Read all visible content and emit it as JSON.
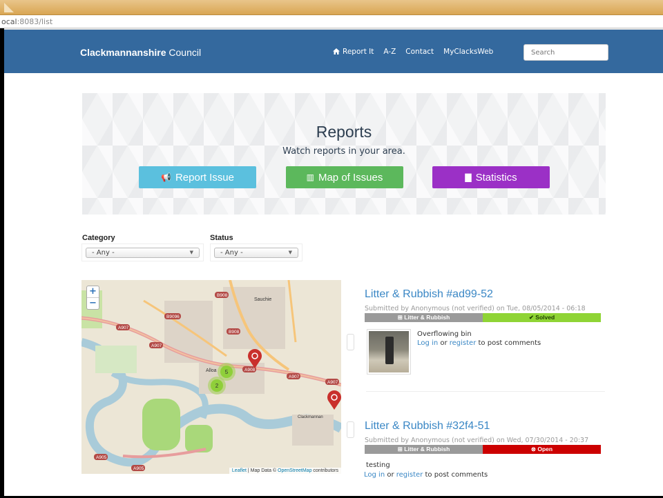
{
  "browser": {
    "url_prefix": "ocal",
    "url_rest": ":8083/list"
  },
  "navbar": {
    "brand_bold": "Clackmannanshire",
    "brand_rest": " Council",
    "links": [
      "Report It",
      "A-Z",
      "Contact",
      "MyClacksWeb"
    ],
    "search_placeholder": "Search"
  },
  "hero": {
    "title": "Reports",
    "subtitle": "Watch reports in your area.",
    "buttons": {
      "report": "Report Issue",
      "map": "Map of Issues",
      "stats": "Statistics"
    }
  },
  "filters": {
    "category_label": "Category",
    "category_value": "- Any -",
    "status_label": "Status",
    "status_value": "- Any -"
  },
  "map": {
    "zoom_in": "+",
    "zoom_out": "−",
    "clusters": [
      "5",
      "2"
    ],
    "places": [
      "Sauchie",
      "Alloa",
      "Clackmannan"
    ],
    "roads": [
      "B908",
      "B9096",
      "A907",
      "A907",
      "B908",
      "A908",
      "A907",
      "A907",
      "A905",
      "A905"
    ],
    "attribution_leaflet": "Leaflet",
    "attribution_mid": " | Map Data © ",
    "attribution_osm": "OpenStreetMap",
    "attribution_end": " contributors"
  },
  "reports": [
    {
      "title": "Litter & Rubbish #ad99-52",
      "meta": "Submitted by Anonymous (not verified) on Tue, 08/05/2014 - 06:18",
      "category": "Litter & Rubbish",
      "status": "Solved",
      "body": "Overflowing bin",
      "login": "Log in",
      "or": " or ",
      "register": "register",
      "post": " to post comments"
    },
    {
      "title": "Litter & Rubbish #32f4-51",
      "meta": "Submitted by Anonymous (not verified) on Wed, 07/30/2014 - 20:37",
      "category": "Litter & Rubbish",
      "status": "Open",
      "body": "testing",
      "login": "Log in",
      "or": " or ",
      "register": "register",
      "post": " to post comments"
    }
  ],
  "colors": {
    "navbar": "#34699e",
    "report_btn": "#5bc0de",
    "map_btn": "#5cb85c",
    "stats_btn": "#9b30c6",
    "solved": "#8fd435",
    "open": "#cc0000"
  }
}
